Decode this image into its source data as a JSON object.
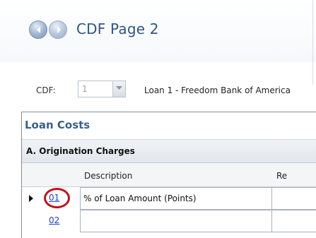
{
  "header": {
    "title": "CDF Page 2",
    "back_icon": "back-arrow-icon",
    "forward_icon": "forward-arrow-icon"
  },
  "cdf_bar": {
    "label": "CDF:",
    "selected": "1",
    "loan_name": "Loan 1 - Freedom Bank of America"
  },
  "panel": {
    "section_title": "Loan Costs",
    "subsection_title": "A. Origination Charges",
    "columns": [
      "Description",
      "Re"
    ],
    "rows": [
      {
        "number": "01",
        "description": "% of Loan Amount (Points)",
        "current": true
      },
      {
        "number": "02",
        "description": "",
        "current": false
      }
    ]
  },
  "colors": {
    "title": "#2e5688",
    "section_title": "#3a5f8c",
    "link": "#1a3fd0",
    "highlight": "#c3121b"
  }
}
